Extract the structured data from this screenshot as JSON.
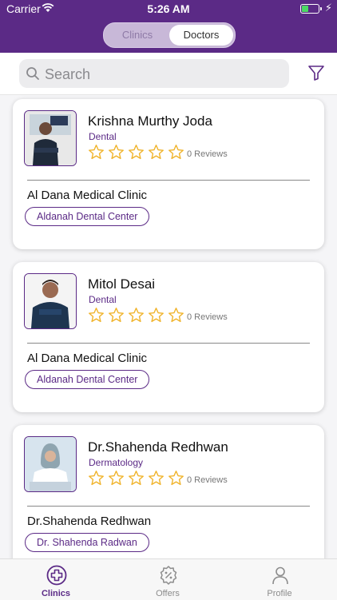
{
  "status_bar": {
    "carrier": "Carrier",
    "time": "5:26 AM"
  },
  "segment": {
    "options": [
      "Clinics",
      "Doctors"
    ],
    "selected": "Doctors"
  },
  "search": {
    "placeholder": "Search"
  },
  "doctors": [
    {
      "name": "Krishna Murthy Joda",
      "specialty": "Dental",
      "rating": 0,
      "reviews": "0 Reviews",
      "clinic": "Al Dana Medical Clinic",
      "tag": "Aldanah Dental Center"
    },
    {
      "name": "Mitol Desai",
      "specialty": "Dental",
      "rating": 0,
      "reviews": "0 Reviews",
      "clinic": "Al Dana Medical Clinic",
      "tag": "Aldanah Dental Center"
    },
    {
      "name": "Dr.Shahenda Redhwan",
      "specialty": "Dermatology",
      "rating": 0,
      "reviews": "0 Reviews",
      "clinic": "Dr.Shahenda Redhwan",
      "tag": "Dr. Shahenda Radwan"
    }
  ],
  "tabbar": {
    "tabs": [
      {
        "label": "Clinics",
        "icon": "medical-cross-icon",
        "active": true
      },
      {
        "label": "Offers",
        "icon": "discount-badge-icon",
        "active": false
      },
      {
        "label": "Profile",
        "icon": "person-icon",
        "active": false
      }
    ]
  },
  "colors": {
    "brand": "#5b2a86",
    "star": "#f0b32a",
    "battery": "#4cd964"
  }
}
